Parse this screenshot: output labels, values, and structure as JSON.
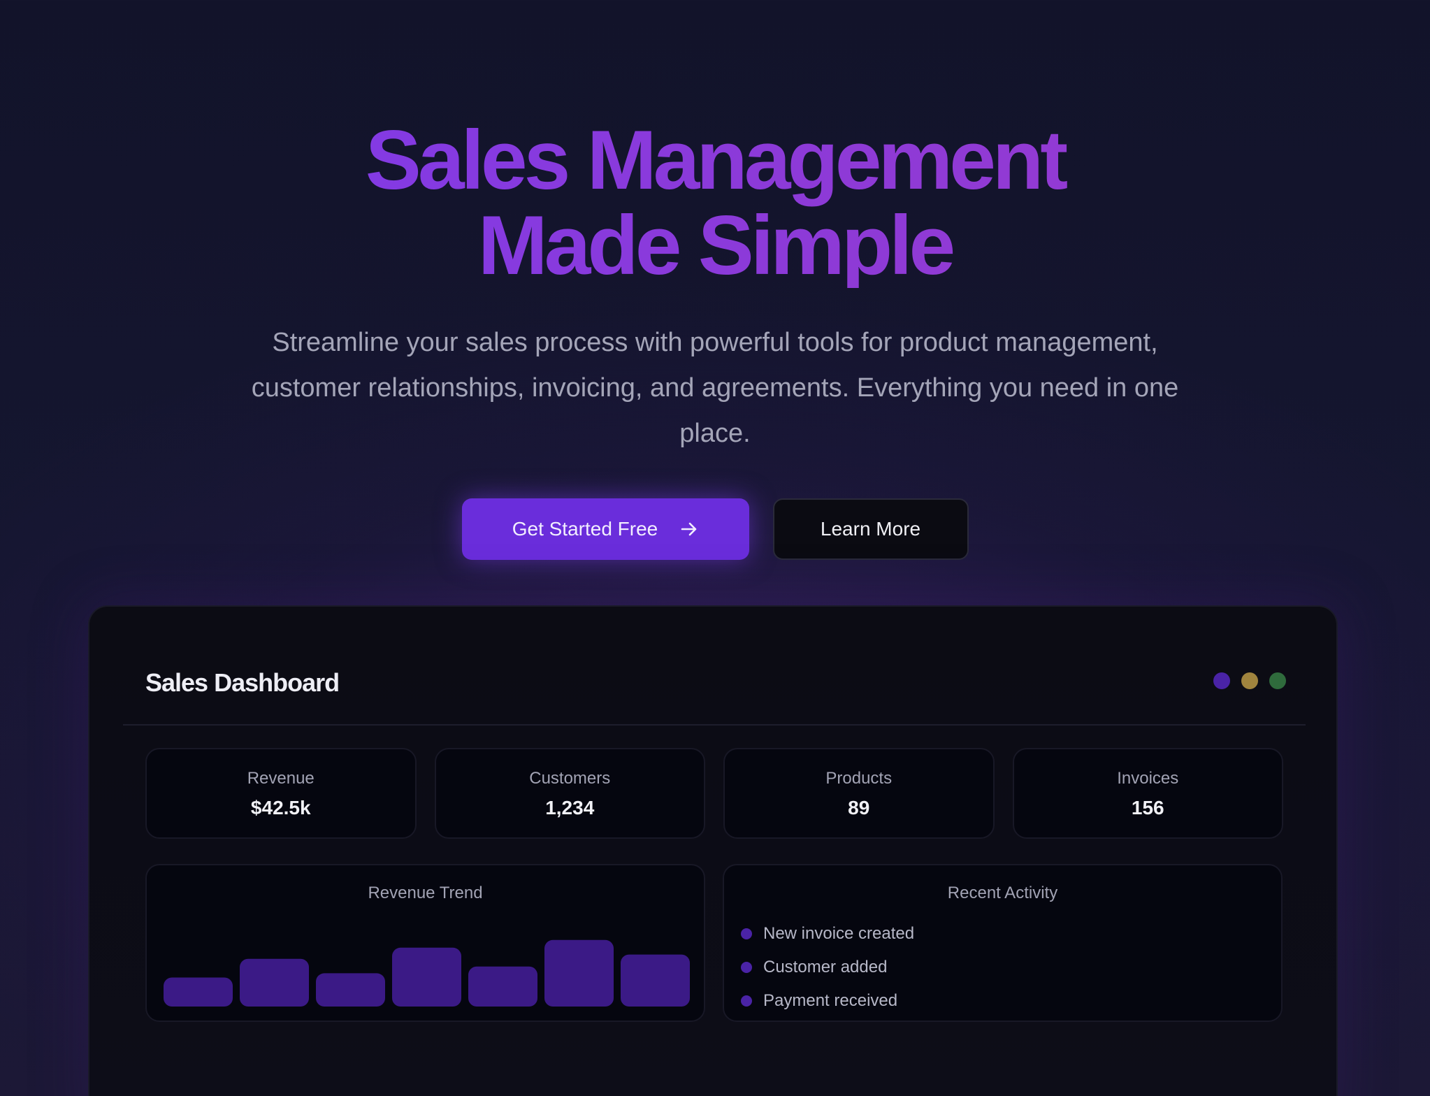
{
  "hero": {
    "title_line1": "Sales Management",
    "title_line2": "Made Simple",
    "subtitle": "Streamline your sales process with powerful tools for product management, customer relationships, invoicing, and agreements. Everything you need in one place.",
    "primary_cta": "Get Started Free",
    "primary_cta_icon": "arrow-right-icon",
    "secondary_cta": "Learn More"
  },
  "dashboard": {
    "title": "Sales Dashboard",
    "window_dots": [
      {
        "name": "purple-dot",
        "color": "#4a23a6"
      },
      {
        "name": "gold-dot",
        "color": "#a0843e"
      },
      {
        "name": "green-dot",
        "color": "#2f6b3c"
      }
    ],
    "stats": [
      {
        "label": "Revenue",
        "value": "$42.5k"
      },
      {
        "label": "Customers",
        "value": "1,234"
      },
      {
        "label": "Products",
        "value": "89"
      },
      {
        "label": "Invoices",
        "value": "156"
      }
    ],
    "revenue_trend": {
      "title": "Revenue Trend"
    },
    "recent_activity": {
      "title": "Recent Activity",
      "items": [
        "New invoice created",
        "Customer added",
        "Payment received"
      ]
    }
  },
  "colors": {
    "accent": "#6a2ddb",
    "title_gradient_start": "#7c3aed",
    "bar_fill": "#3b1a86",
    "bullet": "#4a23a6"
  },
  "chart_data": {
    "type": "bar",
    "values": [
      0.34,
      0.56,
      0.39,
      0.69,
      0.47,
      0.78,
      0.61
    ],
    "ylim": [
      0,
      1
    ]
  }
}
